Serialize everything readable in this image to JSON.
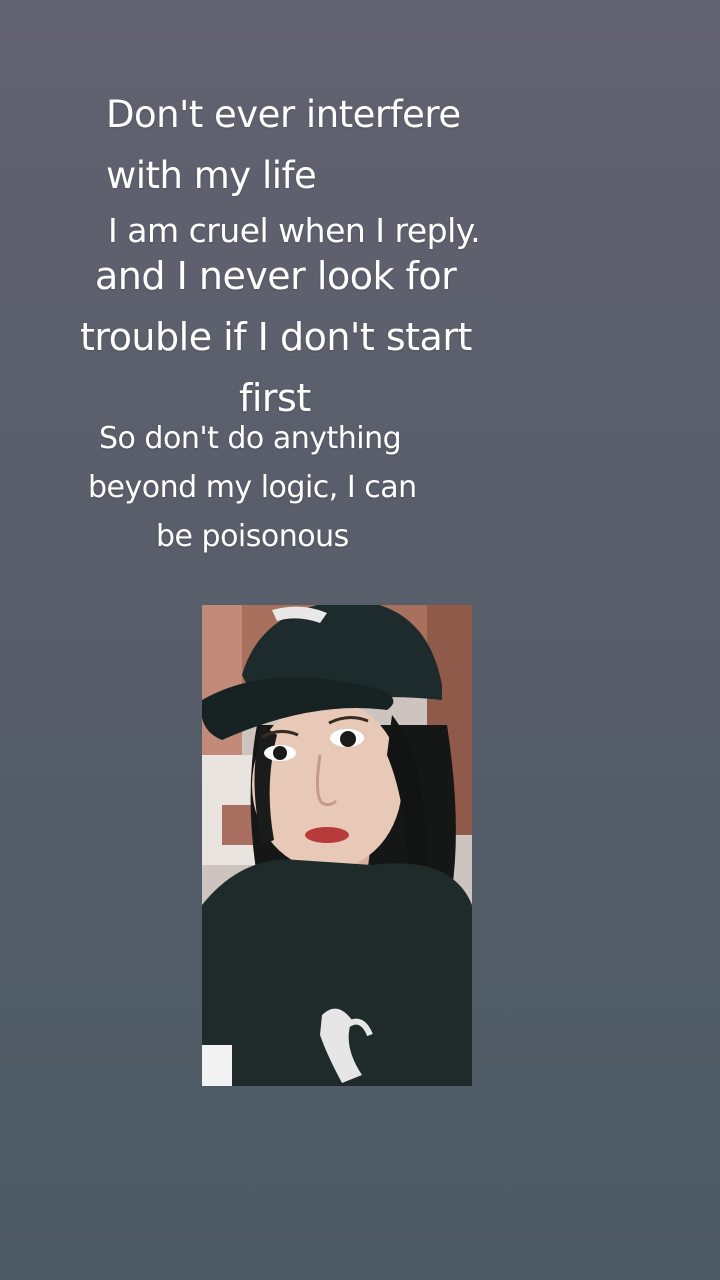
{
  "quote": {
    "line1": "Don't ever interfere",
    "line2": "with my life",
    "line3": "I am cruel when I reply.",
    "line4": "and I never look for",
    "line5": "trouble if I don't start",
    "line6": "first",
    "line7": "So don't do anything",
    "line8": "beyond my logic, I can",
    "line9": "be poisonous"
  },
  "photo": {
    "description_icon": "selfie-photo",
    "colors": {
      "cap": "#1c2a2b",
      "shirt": "#1e2a2a",
      "hair": "#141616",
      "skin": "#e4c3b1",
      "lips": "#b83a3a",
      "background_wall": "#c9bcb8"
    }
  }
}
